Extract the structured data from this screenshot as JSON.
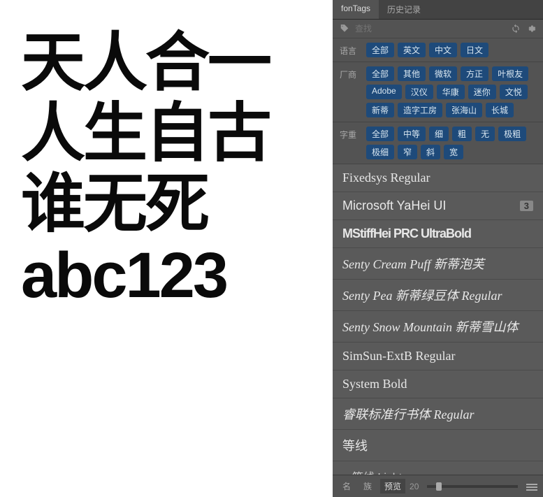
{
  "preview": {
    "line1": "天人合一",
    "line2": "人生自古",
    "line3": "谁无死",
    "line4": "abc123"
  },
  "tabs": {
    "active": "fonTags",
    "other": "历史记录"
  },
  "search": {
    "placeholder": "查找"
  },
  "filters": {
    "language": {
      "label": "语言",
      "tags": [
        "全部",
        "英文",
        "中文",
        "日文"
      ]
    },
    "vendor": {
      "label": "厂商",
      "tags": [
        "全部",
        "其他",
        "微软",
        "方正",
        "叶根友",
        "Adobe",
        "汉仪",
        "华康",
        "迷你",
        "文悦",
        "新蒂",
        "造字工房",
        "张海山",
        "长城"
      ]
    },
    "weight": {
      "label": "字重",
      "tags": [
        "全部",
        "中等",
        "细",
        "粗",
        "无",
        "极粗",
        "极细",
        "窄",
        "斜",
        "宽"
      ]
    }
  },
  "fonts": [
    {
      "name": "Fixedsys Regular",
      "style": "name"
    },
    {
      "name": "Microsoft YaHei UI",
      "style": "sans",
      "badge": "3"
    },
    {
      "name": "MStiffHei PRC UltraBold",
      "style": "bold"
    },
    {
      "name": "Senty Cream Puff 新蒂泡芙",
      "style": "script"
    },
    {
      "name": "Senty Pea 新蒂绿豆体 Regular",
      "style": "script"
    },
    {
      "name": "Senty Snow Mountain 新蒂雪山体",
      "style": "script"
    },
    {
      "name": "SimSun-ExtB Regular",
      "style": "name"
    },
    {
      "name": "System Bold",
      "style": "name"
    },
    {
      "name": "睿联标准行书体 Regular",
      "style": "script"
    },
    {
      "name": "等线",
      "style": "sans"
    },
    {
      "name": "等线 Light",
      "style": "sans",
      "sub": true
    }
  ],
  "footer": {
    "name_btn": "名",
    "family_btn": "族",
    "preview_btn": "预览",
    "size": "20"
  }
}
